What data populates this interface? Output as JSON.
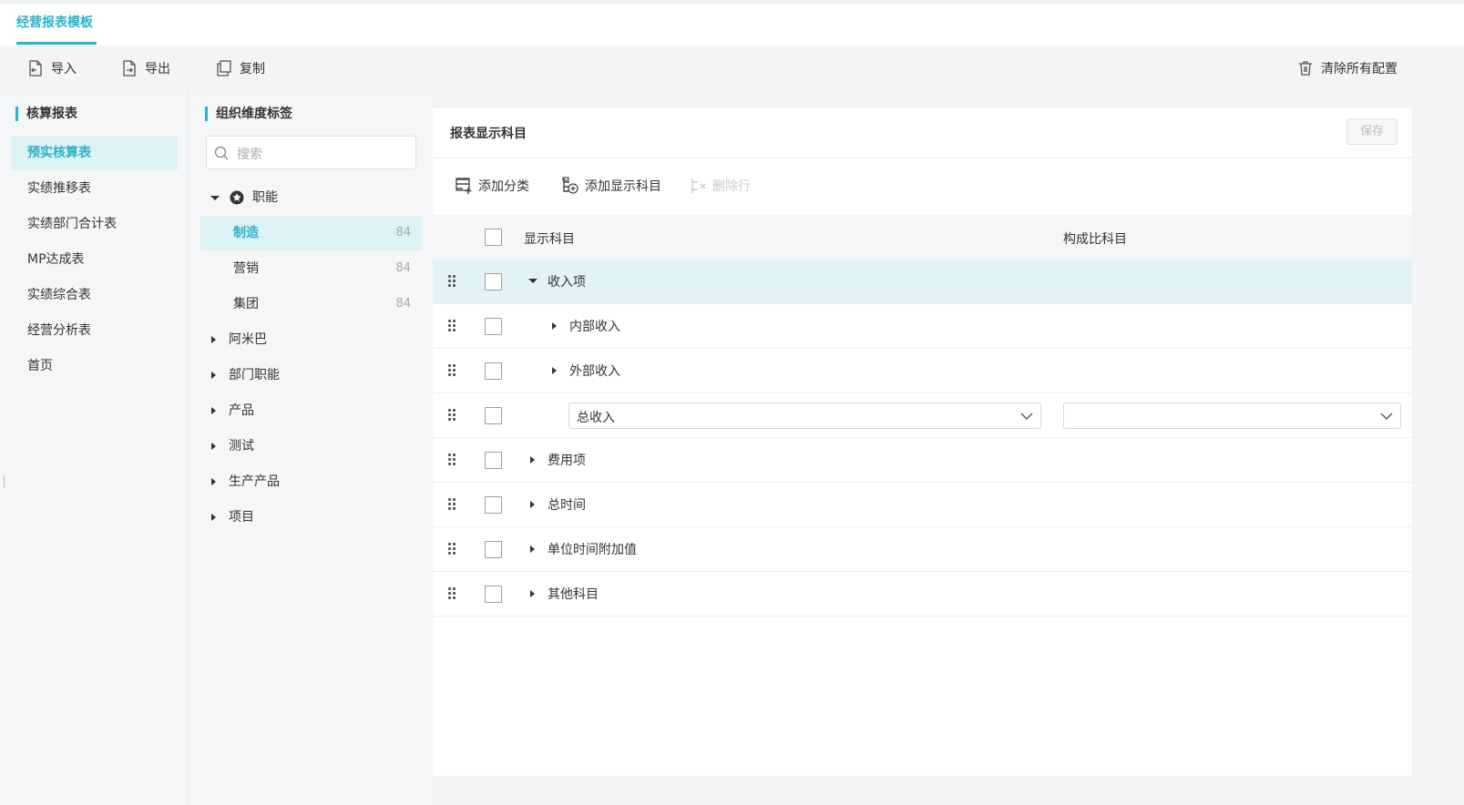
{
  "tabs": [
    {
      "label": "经营报表模板"
    }
  ],
  "toolbar": {
    "import_label": "导入",
    "export_label": "导出",
    "copy_label": "复制",
    "clear_label": "清除所有配置"
  },
  "sidebar": {
    "title": "核算报表",
    "items": [
      {
        "label": "预实核算表",
        "active": true
      },
      {
        "label": "实绩推移表"
      },
      {
        "label": "实绩部门合计表"
      },
      {
        "label": "MP达成表"
      },
      {
        "label": "实绩综合表"
      },
      {
        "label": "经营分析表"
      },
      {
        "label": "首页"
      }
    ]
  },
  "org_panel": {
    "title": "组织维度标签",
    "search_placeholder": "搜索",
    "tree": [
      {
        "label": "职能",
        "expanded": true,
        "icon": "star-circle-icon"
      },
      {
        "label": "制造",
        "count": "84",
        "active": true
      },
      {
        "label": "营销",
        "count": "84"
      },
      {
        "label": "集团",
        "count": "84"
      },
      {
        "label": "阿米巴"
      },
      {
        "label": "部门职能"
      },
      {
        "label": "产品"
      },
      {
        "label": "测试"
      },
      {
        "label": "生产产品"
      },
      {
        "label": "项目"
      }
    ]
  },
  "main": {
    "title": "报表显示科目",
    "save_label": "保存",
    "actions": {
      "add_category": "添加分类",
      "add_subject": "添加显示科目",
      "delete_row": "删除行"
    },
    "columns": {
      "subject": "显示科目",
      "ratio": "构成比科目"
    },
    "rows": [
      {
        "label": "收入项",
        "expanded": true
      },
      {
        "label": "内部收入"
      },
      {
        "label": "外部收入"
      },
      {
        "select_value": "总收入",
        "ratio_value": ""
      },
      {
        "label": "费用项"
      },
      {
        "label": "总时间"
      },
      {
        "label": "单位时间附加值"
      },
      {
        "label": "其他科目"
      }
    ]
  },
  "colors": {
    "accent": "#2ab3c6",
    "highlight": "#dcf2f5"
  }
}
